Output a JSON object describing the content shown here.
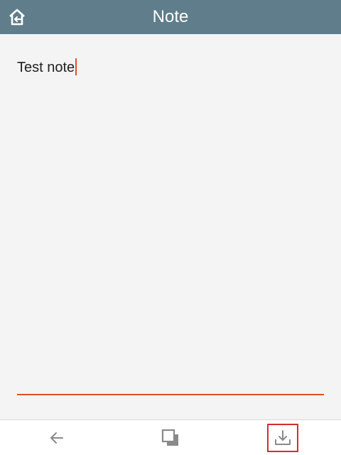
{
  "header": {
    "title": "Note",
    "home_icon": "home-back-icon"
  },
  "editor": {
    "text": "Test note",
    "accent_color": "#e0521f"
  },
  "toolbar": {
    "buttons": [
      {
        "icon": "arrow-left-icon"
      },
      {
        "icon": "copy-icon"
      },
      {
        "icon": "download-icon"
      }
    ]
  },
  "colors": {
    "titlebar": "#607d8b",
    "background": "#f4f4f4",
    "highlight": "#d32f2f"
  }
}
